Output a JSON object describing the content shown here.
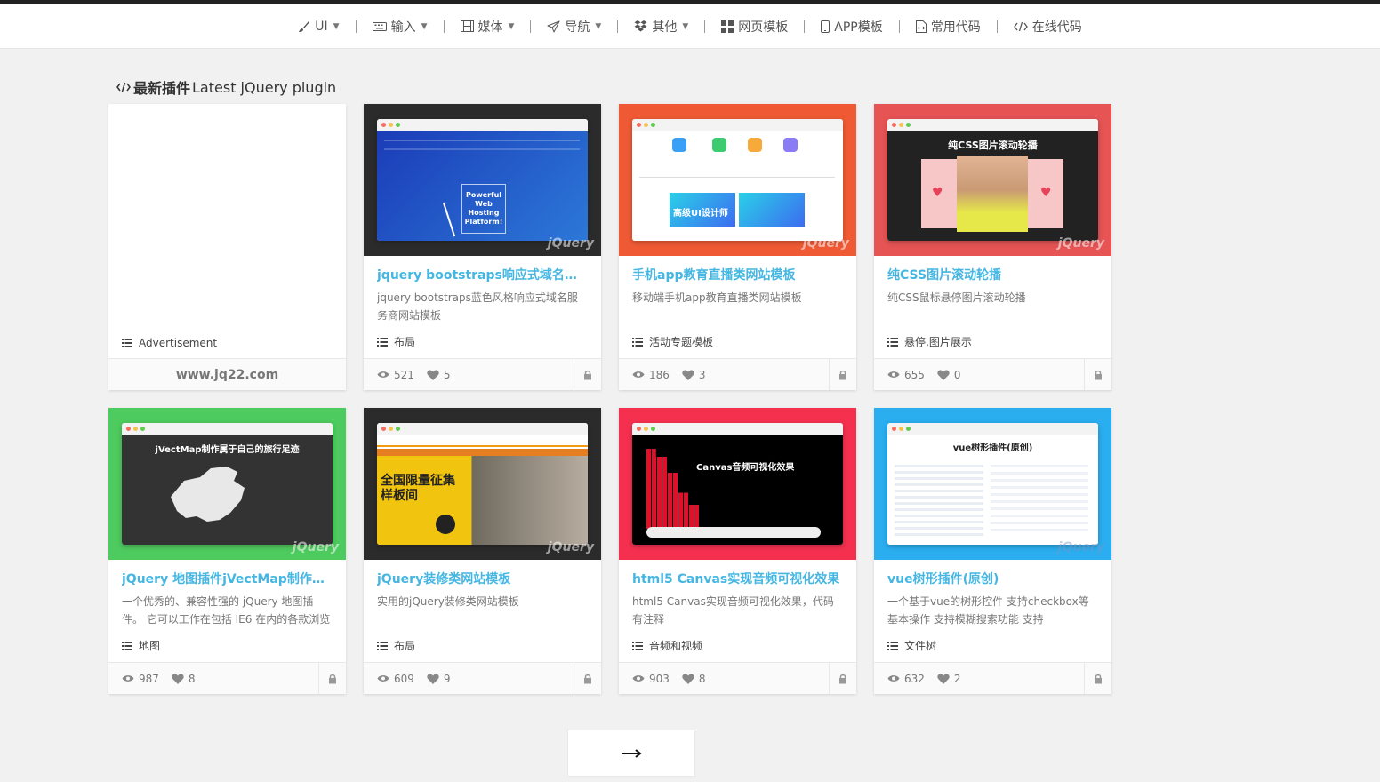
{
  "nav": {
    "items": [
      {
        "label": "UI",
        "icon": "brush-icon",
        "caret": true
      },
      {
        "label": "输入",
        "icon": "keyboard-icon",
        "caret": true
      },
      {
        "label": "媒体",
        "icon": "film-icon",
        "caret": true
      },
      {
        "label": "导航",
        "icon": "send-icon",
        "caret": true
      },
      {
        "label": "其他",
        "icon": "dropbox-icon",
        "caret": true
      },
      {
        "label": "网页模板",
        "icon": "grid-icon",
        "caret": false
      },
      {
        "label": "APP模板",
        "icon": "mobile-icon",
        "caret": false
      },
      {
        "label": "常用代码",
        "icon": "file-code-icon",
        "caret": false
      },
      {
        "label": "在线代码",
        "icon": "code-icon",
        "caret": false
      }
    ]
  },
  "section": {
    "title_bold": "最新插件",
    "title_rest": " Latest jQuery plugin"
  },
  "ad": {
    "tag": "Advertisement",
    "footer": "www.jq22.com"
  },
  "cards": [
    {
      "title": "jquery bootstraps响应式域名服...",
      "desc": "jquery bootstraps蓝色风格响应式域名服务商网站模板",
      "tag": "布局",
      "views": "521",
      "likes": "5",
      "bg": "#2b2b2b",
      "thumb_text": "Powerful Web Hosting Platform!"
    },
    {
      "title": "手机app教育直播类网站模板",
      "desc": "移动端手机app教育直播类网站模板",
      "tag": "活动专题模板",
      "views": "186",
      "likes": "3",
      "bg": "#ef5a35",
      "thumb_text": "高级UI设计师"
    },
    {
      "title": "纯CSS图片滚动轮播",
      "desc": "纯CSS鼠标悬停图片滚动轮播",
      "tag": "悬停,图片展示",
      "views": "655",
      "likes": "0",
      "bg": "#e65454",
      "thumb_text": "纯CSS图片滚动轮播"
    },
    {
      "title": "jQuery 地图插件jVectMap制作属...",
      "desc": "一个优秀的、兼容性强的 jQuery 地图插件。 它可以工作在包括 IE6 在内的各款浏览",
      "tag": "地图",
      "views": "987",
      "likes": "8",
      "bg": "#4ecb5f",
      "thumb_text": "jVectMap制作属于自己的旅行足迹"
    },
    {
      "title": "jQuery装修类网站模板",
      "desc": "实用的jQuery装修类网站模板",
      "tag": "布局",
      "views": "609",
      "likes": "9",
      "bg": "#2b2b2b",
      "thumb_text": "全国限量征集样板间"
    },
    {
      "title": "html5 Canvas实现音频可视化效果",
      "desc": "html5 Canvas实现音频可视化效果，代码有注释",
      "tag": "音频和视频",
      "views": "903",
      "likes": "8",
      "bg": "#f5304f",
      "thumb_text": "Canvas音频可视化效果"
    },
    {
      "title": "vue树形插件(原创)",
      "desc": "一个基于vue的树形控件 支持checkbox等基本操作 支持模糊搜索功能 支持scopedSlots",
      "tag": "文件树",
      "views": "632",
      "likes": "2",
      "bg": "#2aaef0",
      "thumb_text": "vue树形插件(原创)"
    }
  ],
  "next_arrow": "⟶"
}
